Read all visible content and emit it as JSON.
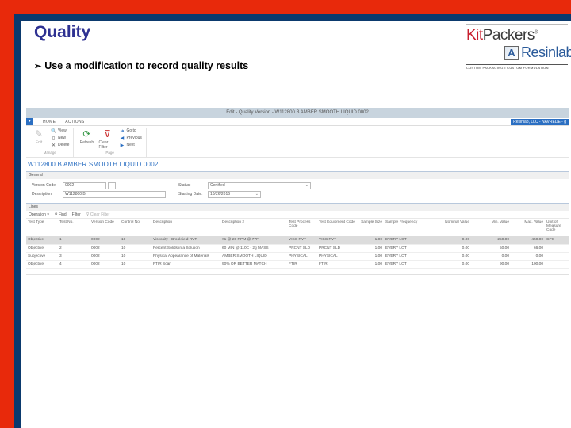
{
  "slide": {
    "title": "Quality",
    "bullet": "Use a modification to record quality results",
    "colors": {
      "frame_red": "#e8290b",
      "frame_navy": "#0b3a6e",
      "title": "#2e3192",
      "accent": "#2b6fc2"
    }
  },
  "logo": {
    "kit": "Kit",
    "packers": "Packers",
    "registered": "®",
    "resinlab": "Resinlab",
    "tagline": "CUSTOM PACKAGING • CUSTOM FORMULATION"
  },
  "app": {
    "window_title": "Edit - Quality Version - W112800 B AMBER SMOOTH LIQUID 0002",
    "company_badge": "Resinlab, LLC - NAVREDE - g",
    "ribbon_tabs": [
      "HOME",
      "ACTIONS"
    ],
    "ribbon": {
      "manage": {
        "label": "Manage",
        "edit": "Edit",
        "view": "View",
        "new": "New",
        "delete": "Delete"
      },
      "page": {
        "label": "Page",
        "refresh": "Refresh",
        "clear_filter": "Clear Filter",
        "go_to": "Go to",
        "previous": "Previous",
        "next": "Next"
      }
    },
    "record_title": "W112800 B AMBER SMOOTH LIQUID 0002",
    "general": {
      "section_label": "General",
      "version_code_label": "Version Code:",
      "version_code_value": "0002",
      "description_label": "Description:",
      "description_value": "W112800 B",
      "status_label": "Status:",
      "status_value": "Certified",
      "starting_date_label": "Starting Date:",
      "starting_date_value": "10/26/2016",
      "ellipsis": "..."
    },
    "lines": {
      "section_label": "Lines",
      "toolbar": {
        "operation": "Operation",
        "find": "Find",
        "filter": "Filter",
        "clear_filter": "Clear Filter"
      },
      "columns": [
        "Test Type",
        "Test No.",
        "Version Code",
        "Control No.",
        "Description",
        "Description 2",
        "Test Process Code",
        "Test Equipment Code",
        "Sample Size",
        "Sample Frequency",
        "Nominal Value",
        "Min. Value",
        "Max. Value",
        "Unit of Measure Code"
      ],
      "rows": [
        [
          "Objective",
          "1",
          "0002",
          "10",
          "Viscosity - Brookfield RVT",
          "#1 @ 20 RPM @ 77F",
          "VISC RVT",
          "VISC RVT",
          "1.00",
          "EVERY LOT",
          "0.00",
          "250.00",
          "450.00",
          "CPS"
        ],
        [
          "Objective",
          "2",
          "0002",
          "10",
          "Percent Solids in a Solution",
          "60 MIN @ 110C - 2g MASS",
          "PRCNT SLD",
          "PRCNT SLD",
          "1.00",
          "EVERY LOT",
          "0.00",
          "50.00",
          "66.00",
          ""
        ],
        [
          "Subjective",
          "3",
          "0002",
          "10",
          "Physical Appearance of Materials",
          "AMBER SMOOTH LIQUID",
          "PHYSICAL",
          "PHYSICAL",
          "1.00",
          "EVERY LOT",
          "0.00",
          "0.00",
          "0.00",
          ""
        ],
        [
          "Objective",
          "4",
          "0002",
          "10",
          "FTIR Scan",
          "90% OR BETTER MATCH",
          "FTIR",
          "FTIR",
          "1.00",
          "EVERY LOT",
          "0.00",
          "90.00",
          "100.00",
          ""
        ]
      ],
      "selected_row": 0
    }
  }
}
